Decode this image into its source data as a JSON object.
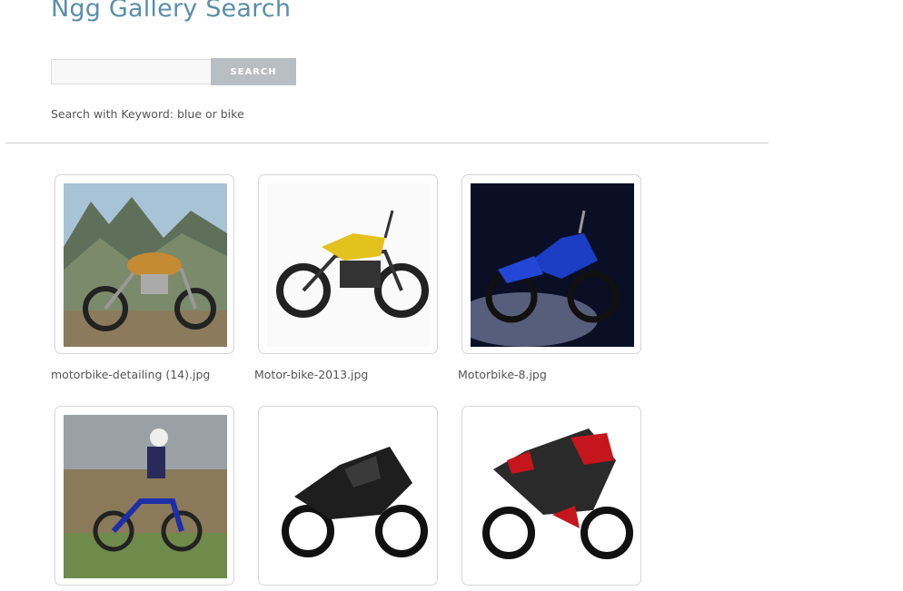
{
  "page": {
    "title": "Ngg Gallery Search"
  },
  "search": {
    "value": "",
    "placeholder": "",
    "button_label": "SEARCH",
    "hint": "Search with Keyword: blue or bike"
  },
  "gallery": {
    "items": [
      {
        "caption": "motorbike-detailing (14).jpg",
        "image": "orange-cruiser-motorcycle-mountains"
      },
      {
        "caption": "Motor-bike-2013.jpg",
        "image": "yellow-electric-motorcycle"
      },
      {
        "caption": "Motorbike-8.jpg",
        "image": "blue-sport-motorcycle-smoke"
      },
      {
        "caption": "",
        "image": "blue-dirt-bike-rider"
      },
      {
        "caption": "",
        "image": "black-sport-bike"
      },
      {
        "caption": "",
        "image": "red-black-sport-bike"
      }
    ]
  }
}
